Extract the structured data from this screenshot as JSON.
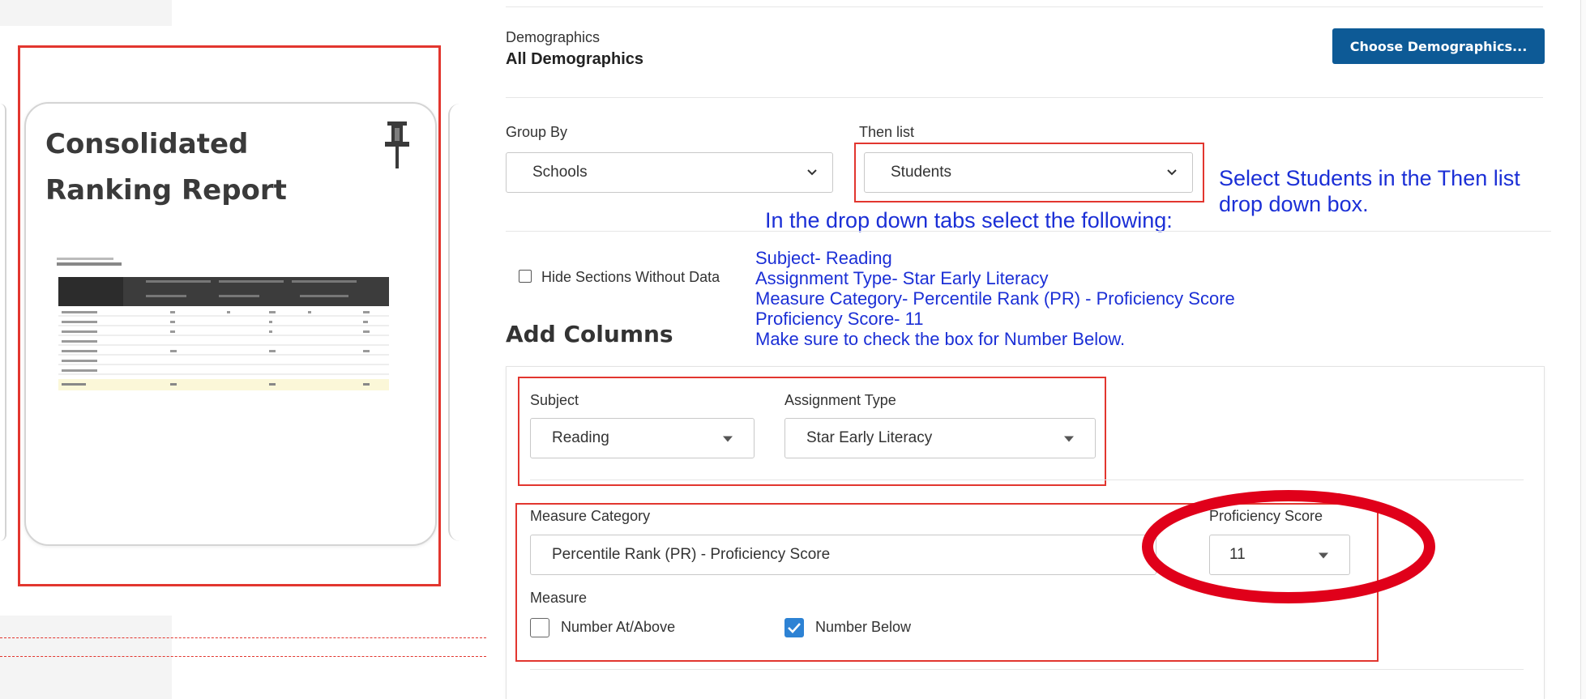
{
  "report_card": {
    "title": "Consolidated Ranking Report"
  },
  "demographics": {
    "label": "Demographics",
    "value": "All Demographics",
    "button_label": "Choose Demographics..."
  },
  "group_by": {
    "label": "Group By",
    "selected": "Schools"
  },
  "then_list": {
    "label": "Then list",
    "selected": "Students"
  },
  "notes": {
    "then_list": [
      "Select Students in the Then list",
      "drop down box."
    ],
    "tabs_heading": "In the drop down tabs select the following:",
    "instructions": [
      "Subject- Reading",
      "Assignment Type- Star Early Literacy",
      "Measure Category- Percentile Rank (PR) - Proficiency Score",
      "Proficiency Score- 11",
      "Make sure to check the box for Number Below."
    ]
  },
  "hide_sections": {
    "label": "Hide Sections Without Data",
    "checked": false
  },
  "add_columns": {
    "heading": "Add Columns",
    "subject": {
      "label": "Subject",
      "selected": "Reading"
    },
    "assignment_type": {
      "label": "Assignment Type",
      "selected": "Star Early Literacy"
    },
    "measure_category": {
      "label": "Measure Category",
      "selected": "Percentile Rank (PR) - Proficiency Score"
    },
    "proficiency_score": {
      "label": "Proficiency Score",
      "selected": "11"
    },
    "measure": {
      "label": "Measure",
      "options": [
        {
          "label": "Number At/Above",
          "checked": false
        },
        {
          "label": "Number Below",
          "checked": true
        }
      ]
    }
  },
  "colors": {
    "highlight_red": "#e2362f",
    "note_blue": "#1b2fd6",
    "button_blue": "#0d5a96",
    "check_blue": "#2d82d4"
  },
  "icons": [
    "pin-icon",
    "chevron-down-icon",
    "caret-down-icon",
    "checkmark-icon"
  ]
}
